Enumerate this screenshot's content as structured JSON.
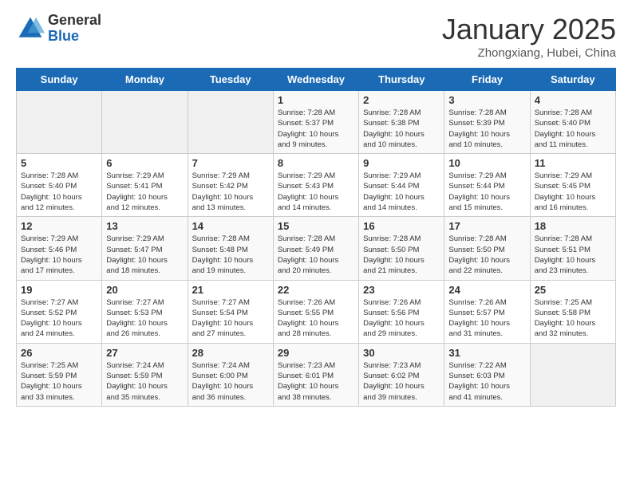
{
  "header": {
    "logo_general": "General",
    "logo_blue": "Blue",
    "title": "January 2025",
    "subtitle": "Zhongxiang, Hubei, China"
  },
  "days_of_week": [
    "Sunday",
    "Monday",
    "Tuesday",
    "Wednesday",
    "Thursday",
    "Friday",
    "Saturday"
  ],
  "weeks": [
    [
      {
        "day": "",
        "info": ""
      },
      {
        "day": "",
        "info": ""
      },
      {
        "day": "",
        "info": ""
      },
      {
        "day": "1",
        "info": "Sunrise: 7:28 AM\nSunset: 5:37 PM\nDaylight: 10 hours\nand 9 minutes."
      },
      {
        "day": "2",
        "info": "Sunrise: 7:28 AM\nSunset: 5:38 PM\nDaylight: 10 hours\nand 10 minutes."
      },
      {
        "day": "3",
        "info": "Sunrise: 7:28 AM\nSunset: 5:39 PM\nDaylight: 10 hours\nand 10 minutes."
      },
      {
        "day": "4",
        "info": "Sunrise: 7:28 AM\nSunset: 5:40 PM\nDaylight: 10 hours\nand 11 minutes."
      }
    ],
    [
      {
        "day": "5",
        "info": "Sunrise: 7:28 AM\nSunset: 5:40 PM\nDaylight: 10 hours\nand 12 minutes."
      },
      {
        "day": "6",
        "info": "Sunrise: 7:29 AM\nSunset: 5:41 PM\nDaylight: 10 hours\nand 12 minutes."
      },
      {
        "day": "7",
        "info": "Sunrise: 7:29 AM\nSunset: 5:42 PM\nDaylight: 10 hours\nand 13 minutes."
      },
      {
        "day": "8",
        "info": "Sunrise: 7:29 AM\nSunset: 5:43 PM\nDaylight: 10 hours\nand 14 minutes."
      },
      {
        "day": "9",
        "info": "Sunrise: 7:29 AM\nSunset: 5:44 PM\nDaylight: 10 hours\nand 14 minutes."
      },
      {
        "day": "10",
        "info": "Sunrise: 7:29 AM\nSunset: 5:44 PM\nDaylight: 10 hours\nand 15 minutes."
      },
      {
        "day": "11",
        "info": "Sunrise: 7:29 AM\nSunset: 5:45 PM\nDaylight: 10 hours\nand 16 minutes."
      }
    ],
    [
      {
        "day": "12",
        "info": "Sunrise: 7:29 AM\nSunset: 5:46 PM\nDaylight: 10 hours\nand 17 minutes."
      },
      {
        "day": "13",
        "info": "Sunrise: 7:29 AM\nSunset: 5:47 PM\nDaylight: 10 hours\nand 18 minutes."
      },
      {
        "day": "14",
        "info": "Sunrise: 7:28 AM\nSunset: 5:48 PM\nDaylight: 10 hours\nand 19 minutes."
      },
      {
        "day": "15",
        "info": "Sunrise: 7:28 AM\nSunset: 5:49 PM\nDaylight: 10 hours\nand 20 minutes."
      },
      {
        "day": "16",
        "info": "Sunrise: 7:28 AM\nSunset: 5:50 PM\nDaylight: 10 hours\nand 21 minutes."
      },
      {
        "day": "17",
        "info": "Sunrise: 7:28 AM\nSunset: 5:50 PM\nDaylight: 10 hours\nand 22 minutes."
      },
      {
        "day": "18",
        "info": "Sunrise: 7:28 AM\nSunset: 5:51 PM\nDaylight: 10 hours\nand 23 minutes."
      }
    ],
    [
      {
        "day": "19",
        "info": "Sunrise: 7:27 AM\nSunset: 5:52 PM\nDaylight: 10 hours\nand 24 minutes."
      },
      {
        "day": "20",
        "info": "Sunrise: 7:27 AM\nSunset: 5:53 PM\nDaylight: 10 hours\nand 26 minutes."
      },
      {
        "day": "21",
        "info": "Sunrise: 7:27 AM\nSunset: 5:54 PM\nDaylight: 10 hours\nand 27 minutes."
      },
      {
        "day": "22",
        "info": "Sunrise: 7:26 AM\nSunset: 5:55 PM\nDaylight: 10 hours\nand 28 minutes."
      },
      {
        "day": "23",
        "info": "Sunrise: 7:26 AM\nSunset: 5:56 PM\nDaylight: 10 hours\nand 29 minutes."
      },
      {
        "day": "24",
        "info": "Sunrise: 7:26 AM\nSunset: 5:57 PM\nDaylight: 10 hours\nand 31 minutes."
      },
      {
        "day": "25",
        "info": "Sunrise: 7:25 AM\nSunset: 5:58 PM\nDaylight: 10 hours\nand 32 minutes."
      }
    ],
    [
      {
        "day": "26",
        "info": "Sunrise: 7:25 AM\nSunset: 5:59 PM\nDaylight: 10 hours\nand 33 minutes."
      },
      {
        "day": "27",
        "info": "Sunrise: 7:24 AM\nSunset: 5:59 PM\nDaylight: 10 hours\nand 35 minutes."
      },
      {
        "day": "28",
        "info": "Sunrise: 7:24 AM\nSunset: 6:00 PM\nDaylight: 10 hours\nand 36 minutes."
      },
      {
        "day": "29",
        "info": "Sunrise: 7:23 AM\nSunset: 6:01 PM\nDaylight: 10 hours\nand 38 minutes."
      },
      {
        "day": "30",
        "info": "Sunrise: 7:23 AM\nSunset: 6:02 PM\nDaylight: 10 hours\nand 39 minutes."
      },
      {
        "day": "31",
        "info": "Sunrise: 7:22 AM\nSunset: 6:03 PM\nDaylight: 10 hours\nand 41 minutes."
      },
      {
        "day": "",
        "info": ""
      }
    ]
  ]
}
